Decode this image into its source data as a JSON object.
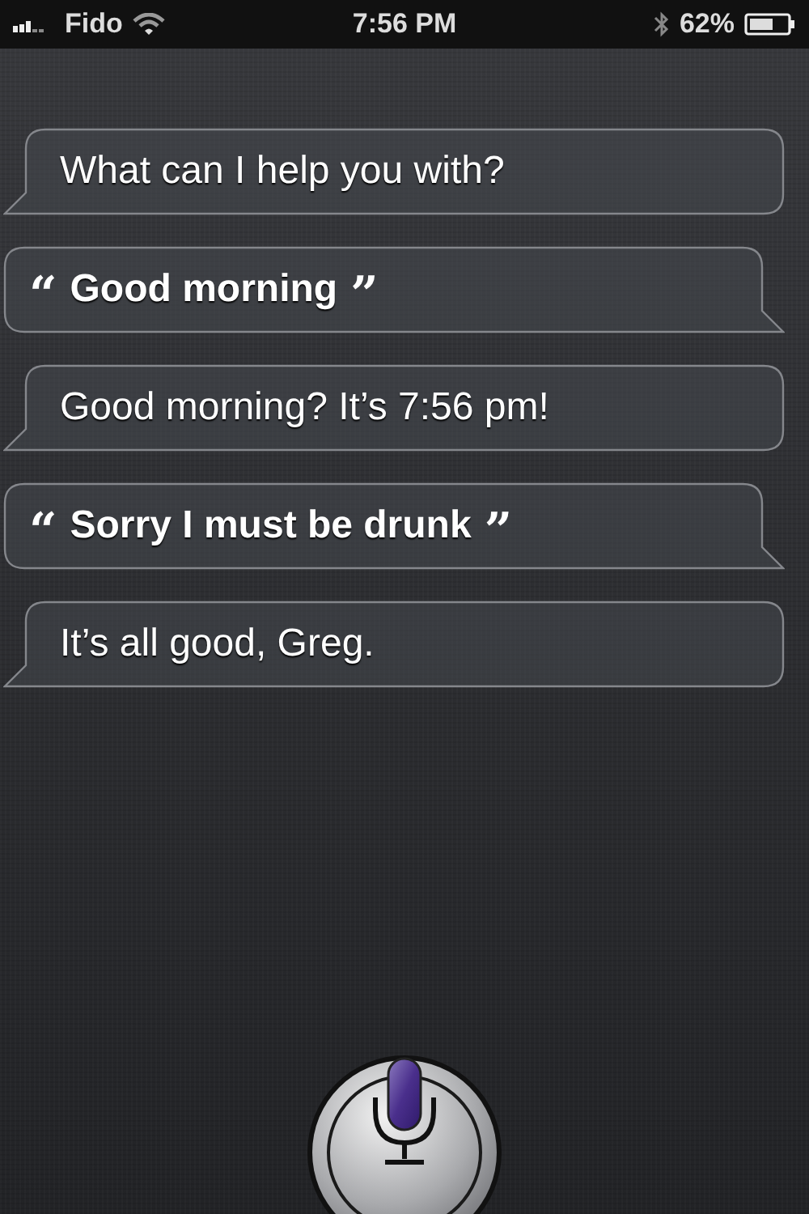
{
  "status_bar": {
    "carrier": "Fido",
    "time": "7:56 PM",
    "battery": "62%"
  },
  "messages": [
    {
      "kind": "siri",
      "text": "What can I help you with?"
    },
    {
      "kind": "user",
      "open_quote": "“",
      "text": "Good morning",
      "close_quote": "”"
    },
    {
      "kind": "siri",
      "text": "Good morning? It’s 7:56 pm!"
    },
    {
      "kind": "user",
      "open_quote": "“",
      "text": "Sorry I must be drunk",
      "close_quote": "”"
    },
    {
      "kind": "siri",
      "text": "It’s all good, Greg."
    }
  ]
}
